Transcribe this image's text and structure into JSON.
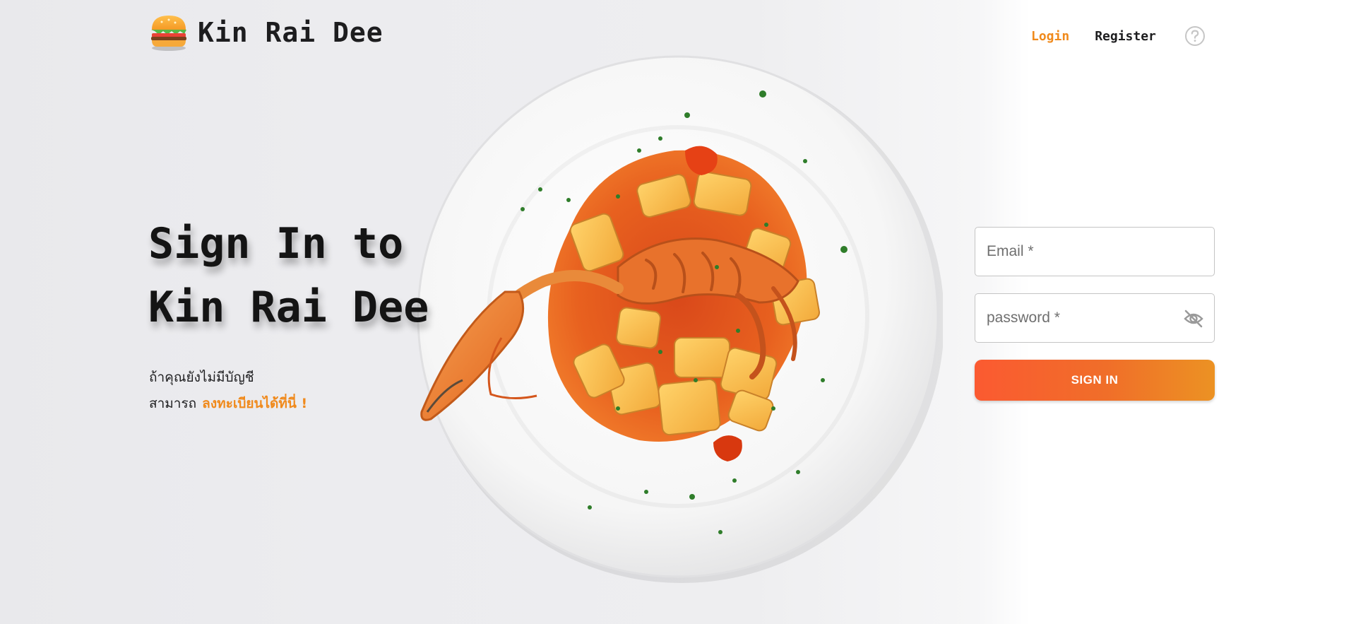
{
  "header": {
    "brand": "Kin Rai Dee",
    "logo_icon": "burger-icon",
    "nav": {
      "login_label": "Login",
      "register_label": "Register",
      "help_icon": "help-circle-icon"
    }
  },
  "hero": {
    "title_line1": "Sign In to",
    "title_line2": "Kin Rai Dee",
    "subtitle_line1": "ถ้าคุณยังไม่มีบัญชี",
    "subtitle_line2_prefix": "สามารถ",
    "register_link": "ลงทะเบียนได้ที่นี่ !",
    "image_icon": "pasta-plate-image"
  },
  "form": {
    "email_placeholder": "Email *",
    "password_placeholder": "password *",
    "password_toggle_icon": "eye-off-icon",
    "submit_label": "SIGN IN"
  },
  "colors": {
    "accent": "#f08a1c",
    "button_start": "#fb5a31",
    "button_end": "#ec9223",
    "text": "#1d1d1f"
  }
}
